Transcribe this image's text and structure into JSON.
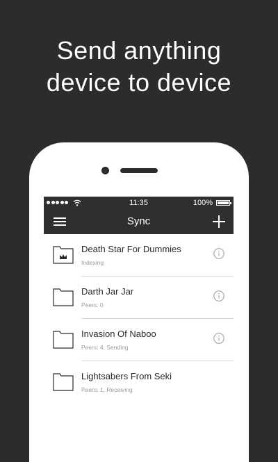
{
  "promo": {
    "headline_line1": "Send anything",
    "headline_line2": "device to device"
  },
  "status_bar": {
    "time": "11:35",
    "battery": "100%",
    "icons": [
      "signal-dots-icon",
      "wifi-icon",
      "battery-icon"
    ]
  },
  "nav": {
    "title": "Sync",
    "left_icon": "menu-icon",
    "right_icon": "add-icon"
  },
  "folders": [
    {
      "name": "Death Star For Dummies",
      "status": "Indexing",
      "icon": "folder-indexing-icon"
    },
    {
      "name": "Darth Jar Jar",
      "status": "Peers: 0",
      "icon": "folder-icon"
    },
    {
      "name": "Invasion Of Naboo",
      "status": "Peers: 4, Sending",
      "icon": "folder-icon"
    },
    {
      "name": "Lightsabers From Seki",
      "status": "Peers: 1, Receiving",
      "icon": "folder-icon"
    }
  ],
  "colors": {
    "background": "#2c2c2c",
    "bar": "#2f2f2f",
    "text": "#2a2a2a",
    "subtext": "#9a9a9a",
    "divider": "#d8d8d8"
  }
}
